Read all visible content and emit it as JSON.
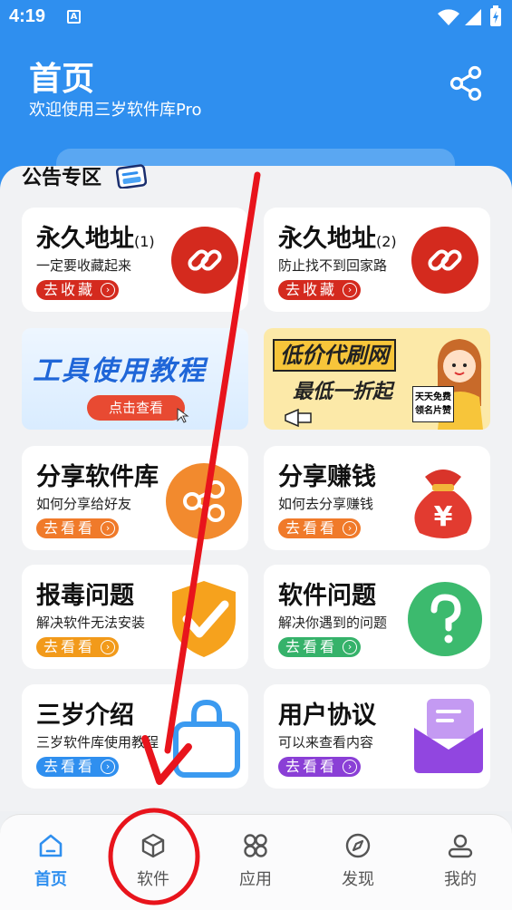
{
  "status": {
    "time": "4:19",
    "notif": "A"
  },
  "header": {
    "title": "首页",
    "subtitle": "欢迎使用三岁软件库Pro"
  },
  "notice": {
    "title": "公告专区"
  },
  "cards": [
    {
      "title": "永久地址",
      "tag": "(1)",
      "desc": "一定要收藏起来",
      "button": "去收藏",
      "color": "#d42a1e"
    },
    {
      "title": "永久地址",
      "tag": "(2)",
      "desc": "防止找不到回家路",
      "button": "去收藏",
      "color": "#d42a1e"
    },
    {
      "title": "分享软件库",
      "desc": "如何分享给好友",
      "button": "去看看",
      "color": "#f07a2a"
    },
    {
      "title": "分享赚钱",
      "desc": "如何去分享赚钱",
      "button": "去看看",
      "color": "#f07a2a"
    },
    {
      "title": "报毒问题",
      "desc": "解决软件无法安装",
      "button": "去看看",
      "color": "#f29a1a"
    },
    {
      "title": "软件问题",
      "desc": "解决你遇到的问题",
      "button": "去看看",
      "color": "#35b26a"
    },
    {
      "title": "三岁介绍",
      "desc": "三岁软件库使用教程",
      "button": "去看看",
      "color": "#2f8fef"
    },
    {
      "title": "用户协议",
      "desc": "可以来查看内容",
      "button": "去看看",
      "color": "#8a3fd6"
    }
  ],
  "banners": {
    "left": {
      "title": "工具使用教程",
      "button": "点击查看"
    },
    "right": {
      "line1": "低价代刷网",
      "line2": "最低一折起",
      "badge1": "天天免费",
      "badge2": "领名片赞"
    }
  },
  "tabs": [
    {
      "label": "首页"
    },
    {
      "label": "软件"
    },
    {
      "label": "应用"
    },
    {
      "label": "发现"
    },
    {
      "label": "我的"
    }
  ],
  "colors": {
    "brand": "#2f8fef",
    "annotation": "#e8141c"
  }
}
